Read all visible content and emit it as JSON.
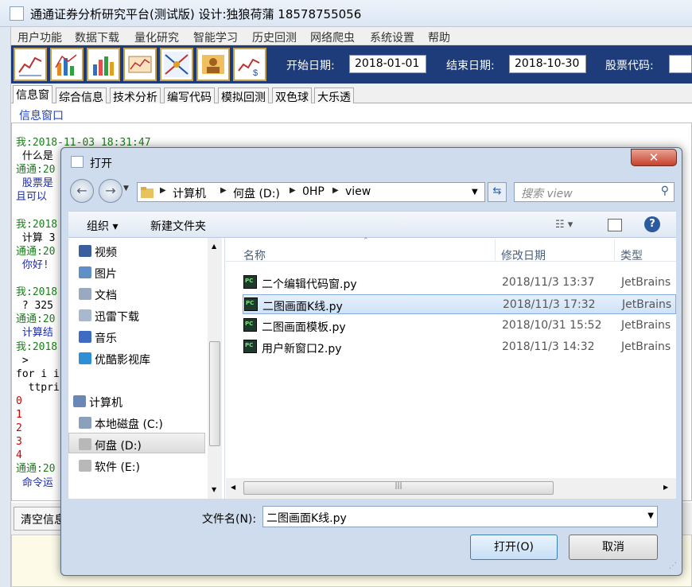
{
  "app": {
    "title": "通通证券分析研究平台(测试版) 设计:独狼荷蒲 18578755056",
    "menu": [
      "用户功能",
      "数据下载",
      "量化研究",
      "智能学习",
      "历史回测",
      "网络爬虫",
      "系统设置",
      "帮助"
    ],
    "toolbar": {
      "start_label": "开始日期:",
      "start_value": "2018-01-01",
      "end_label": "结束日期:",
      "end_value": "2018-10-30",
      "code_label": "股票代码:"
    },
    "tabs": [
      "信息窗",
      "综合信息",
      "技术分析",
      "编写代码",
      "模拟回测",
      "双色球",
      "大乐透"
    ],
    "info_label": "信息窗口",
    "log": [
      {
        "text": "我:2018-11-03 18:31:47",
        "color": "g"
      },
      {
        "text": " 什么是",
        "color": "k"
      },
      {
        "text": "通通:20",
        "color": "g"
      },
      {
        "text": " 股票是",
        "color": "b"
      },
      {
        "text": "且可以",
        "color": "b"
      },
      {
        "text": "",
        "color": "k"
      },
      {
        "text": "我:2018",
        "color": "g"
      },
      {
        "text": " 计算 3",
        "color": "k"
      },
      {
        "text": "通通:20",
        "color": "g"
      },
      {
        "text": " 你好!",
        "color": "b"
      },
      {
        "text": "",
        "color": "k"
      },
      {
        "text": "我:2018",
        "color": "g"
      },
      {
        "text": " ? 325",
        "color": "k"
      },
      {
        "text": "通通:20",
        "color": "g"
      },
      {
        "text": " 计算结",
        "color": "b"
      },
      {
        "text": "我:2018",
        "color": "g"
      },
      {
        "text": " >",
        "color": "k"
      },
      {
        "text": "for i i",
        "color": "k"
      },
      {
        "text": "  ttpri",
        "color": "k"
      },
      {
        "text": "0",
        "color": "r"
      },
      {
        "text": "1",
        "color": "r"
      },
      {
        "text": "2",
        "color": "r"
      },
      {
        "text": "3",
        "color": "r"
      },
      {
        "text": "4",
        "color": "r"
      },
      {
        "text": "通通:20",
        "color": "g"
      },
      {
        "text": " 命令运",
        "color": "b"
      }
    ],
    "clear_label": "清空信息"
  },
  "dialog": {
    "title": "打开",
    "close": "✕",
    "breadcrumb": [
      "计算机",
      "何盘 (D:)",
      "0HP",
      "view"
    ],
    "search_placeholder": "搜索 view",
    "organize": "组织 ▾",
    "new_folder": "新建文件夹",
    "nav_items": [
      {
        "label": "视频",
        "icon": "video-icon",
        "color": "#3b5f9e"
      },
      {
        "label": "图片",
        "icon": "picture-icon",
        "color": "#5e8fc9"
      },
      {
        "label": "文档",
        "icon": "document-icon",
        "color": "#9aa9bf"
      },
      {
        "label": "迅雷下载",
        "icon": "download-icon",
        "color": "#a8b8cf"
      },
      {
        "label": "音乐",
        "icon": "music-icon",
        "color": "#3d6cc2"
      },
      {
        "label": "优酷影视库",
        "icon": "youku-icon",
        "color": "#2e8fd6"
      }
    ],
    "computer_label": "计算机",
    "drives": [
      {
        "label": "本地磁盘 (C:)",
        "icon": "local-disk-icon"
      },
      {
        "label": "何盘 (D:)",
        "icon": "drive-icon"
      },
      {
        "label": "软件 (E:)",
        "icon": "drive-icon"
      }
    ],
    "columns": [
      "名称",
      "修改日期",
      "类型"
    ],
    "files": [
      {
        "name": "二个编辑代码窗.py",
        "date": "2018/11/3 13:37",
        "type": "JetBrains"
      },
      {
        "name": "二图画面K线.py",
        "date": "2018/11/3 17:32",
        "type": "JetBrains"
      },
      {
        "name": "二图画面模板.py",
        "date": "2018/10/31 15:52",
        "type": "JetBrains"
      },
      {
        "name": "用户新窗口2.py",
        "date": "2018/11/3 14:32",
        "type": "JetBrains"
      }
    ],
    "selected_index": 1,
    "filename_label": "文件名(N):",
    "filename_value": "二图画面K线.py",
    "open_label": "打开(O)",
    "cancel_label": "取消"
  }
}
